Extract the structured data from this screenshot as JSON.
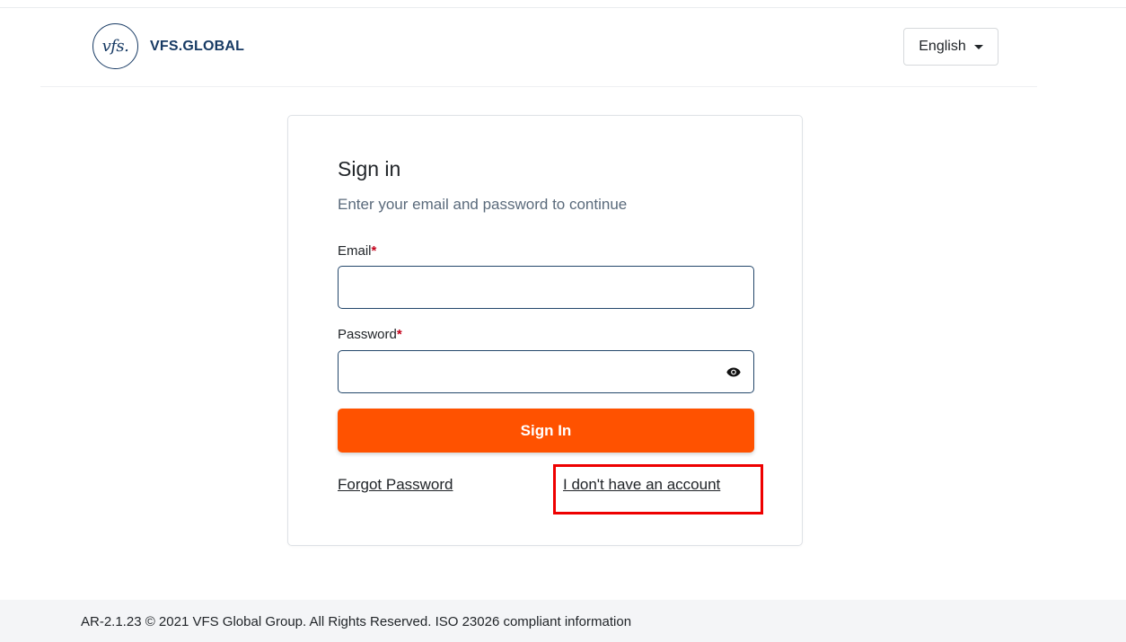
{
  "header": {
    "logo_text": "vfs.",
    "brand": "VFS.GLOBAL",
    "language": "English",
    "language_caret_icon": "caret-down-icon"
  },
  "signin": {
    "title": "Sign in",
    "subtitle": "Enter your email and password to continue",
    "email_label": "Email",
    "password_label": "Password",
    "required_marker": "*",
    "email_value": "",
    "password_value": "",
    "show_password_icon": "eye-icon",
    "submit_label": "Sign In",
    "forgot_label": "Forgot Password",
    "no_account_label": "I don't have an account"
  },
  "annotation": {
    "highlight_color": "#ee0000",
    "highlight_target": "no-account-link"
  },
  "footer": {
    "text": "AR-2.1.23 © 2021 VFS Global Group. All Rights Reserved. ISO 23026 compliant information"
  },
  "colors": {
    "brand_navy": "#173a64",
    "accent_orange": "#ff5200",
    "required_red": "#c4001a",
    "input_border": "#24476b"
  }
}
